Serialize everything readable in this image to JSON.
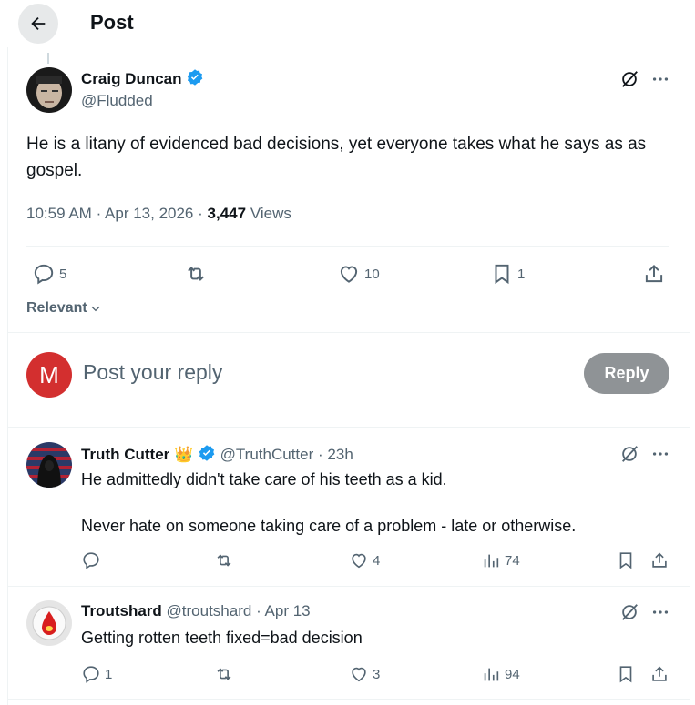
{
  "header": {
    "title": "Post",
    "back_icon": "arrow-left-icon"
  },
  "main_post": {
    "author_name": "Craig Duncan",
    "author_handle": "@Fludded",
    "verified": true,
    "text": "He is a litany of evidenced bad decisions, yet everyone takes what he says as as gospel.",
    "time": "10:59 AM",
    "date": "Apr 13, 2026",
    "views_count": "3,447",
    "views_label": "Views",
    "replies": "5",
    "reposts": "",
    "likes": "10",
    "bookmarks": "1"
  },
  "sort": {
    "label": "Relevant"
  },
  "composer": {
    "avatar_letter": "M",
    "avatar_color": "#d32f2f",
    "placeholder": "Post your reply",
    "reply_label": "Reply"
  },
  "replies": [
    {
      "name": "Truth Cutter",
      "emoji": "👑",
      "verified": true,
      "handle": "@TruthCutter",
      "time": "23h",
      "text_lines": [
        "He admittedly didn't take care of his teeth as a kid.",
        "Never hate on someone taking care of a problem - late or otherwise."
      ],
      "replies": "",
      "reposts": "",
      "likes": "4",
      "views": "74"
    },
    {
      "name": "Troutshard",
      "emoji": "",
      "verified": false,
      "handle": "@troutshard",
      "time": "Apr 13",
      "text_lines": [
        "Getting rotten teeth fixed=bad decision"
      ],
      "replies": "1",
      "reposts": "",
      "likes": "3",
      "views": "94"
    }
  ],
  "separator": "·",
  "colors": {
    "verified_blue": "#1d9bf0",
    "muted": "#536471",
    "text": "#0f1419"
  }
}
